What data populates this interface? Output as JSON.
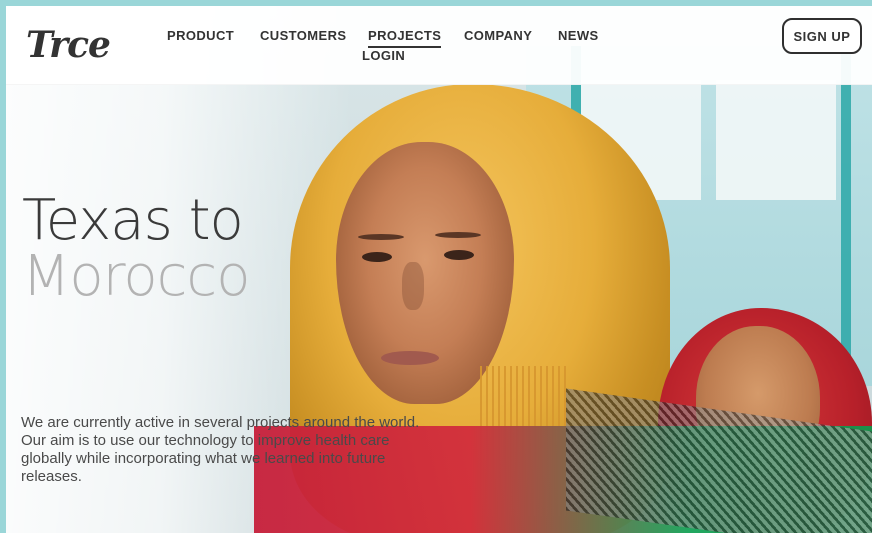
{
  "brand": {
    "logo_text": "Trce"
  },
  "nav": {
    "items": [
      "PRODUCT",
      "CUSTOMERS",
      "PROJECTS",
      "COMPANY",
      "NEWS"
    ],
    "active": "PROJECTS",
    "login_label": "LOGIN",
    "signup_label": "SIGN UP"
  },
  "hero": {
    "title_line1": "Texas to",
    "title_line2": "Morocco",
    "description": "We are currently active in several projects around the world. Our aim is to use our technology to improve health care globally while incorporating what we learned into future releases."
  },
  "icons": {
    "logo": "trace-logo"
  },
  "colors": {
    "page_border": "#9ad6d8",
    "text_dark": "#333333",
    "title_light": "#b3b3b3"
  }
}
